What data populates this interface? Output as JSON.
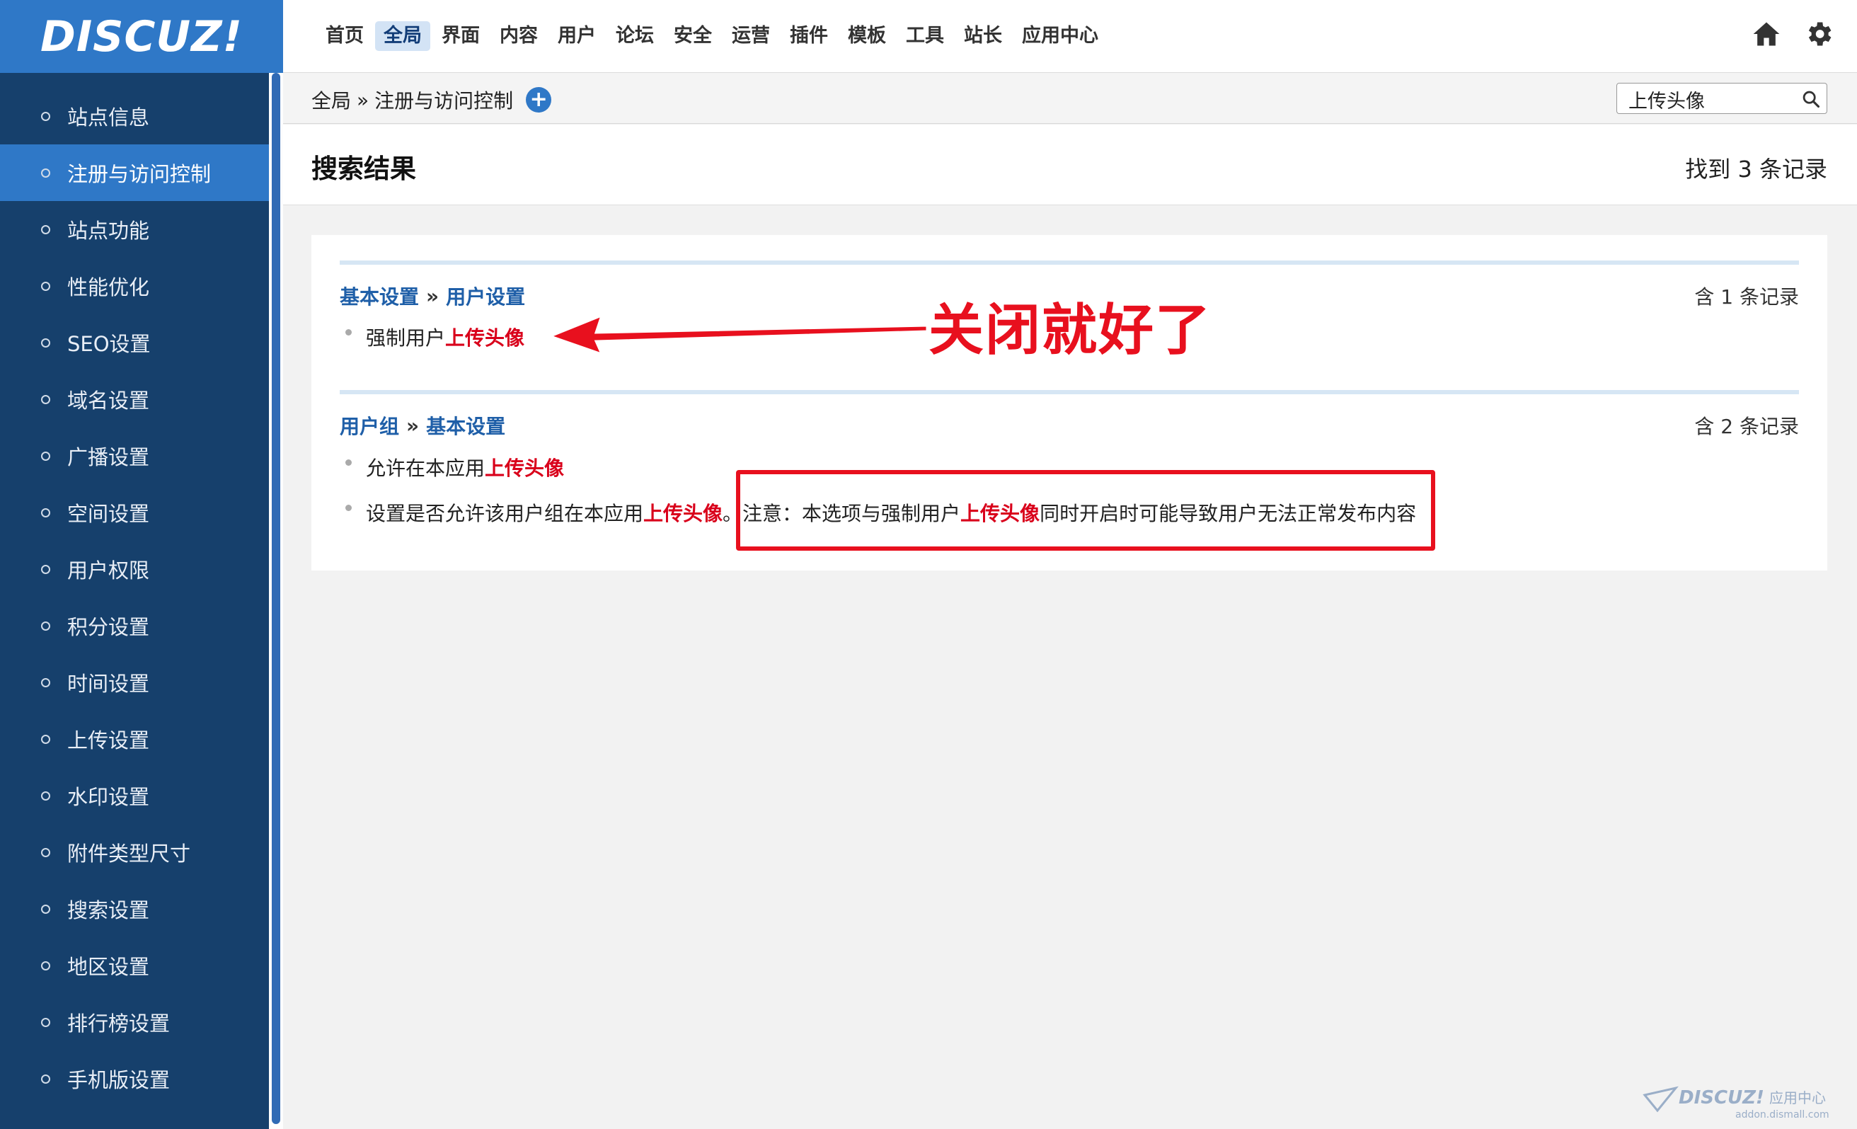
{
  "logo": {
    "text": "DISCUZ!"
  },
  "topnav": {
    "items": [
      "首页",
      "全局",
      "界面",
      "内容",
      "用户",
      "论坛",
      "安全",
      "运营",
      "插件",
      "模板",
      "工具",
      "站长",
      "应用中心"
    ],
    "active_index": 1
  },
  "sidebar": {
    "items": [
      "站点信息",
      "注册与访问控制",
      "站点功能",
      "性能优化",
      "SEO设置",
      "域名设置",
      "广播设置",
      "空间设置",
      "用户权限",
      "积分设置",
      "时间设置",
      "上传设置",
      "水印设置",
      "附件类型尺寸",
      "搜索设置",
      "地区设置",
      "排行榜设置",
      "手机版设置"
    ],
    "active_index": 1
  },
  "breadcrumb": {
    "root": "全局",
    "sep": "»",
    "current": "注册与访问控制"
  },
  "search": {
    "value": "上传头像"
  },
  "result": {
    "title": "搜索结果",
    "count_text": "找到 3 条记录"
  },
  "sections": [
    {
      "crumb1": "基本设置",
      "sep": "»",
      "crumb2": "用户设置",
      "count": "含 1 条记录",
      "items": [
        {
          "pre": "强制用户",
          "hl": "上传头像",
          "post": ""
        }
      ]
    },
    {
      "crumb1": "用户组",
      "sep": "»",
      "crumb2": "基本设置",
      "count": "含 2 条记录",
      "items": [
        {
          "pre": "允许在本应用",
          "hl": "上传头像",
          "post": ""
        },
        {
          "pre": "设置是否允许该用户组在本应用",
          "hl": "上传头像",
          "post": "。注意：本选项与强制用户",
          "hl2": "上传头像",
          "post2": "同时开启时可能导致用户无法正常发布内容"
        }
      ]
    }
  ],
  "annotation": {
    "text": "关闭就好了",
    "color": "#e8101e"
  },
  "watermark": {
    "brand": "DISCUZ!",
    "label": "应用中心",
    "url": "addon.dismall.com"
  },
  "colors": {
    "brand_blue": "#2f78c7",
    "sidebar_bg": "#16406c",
    "highlight_red": "#d9001b",
    "link_blue": "#1f5fa8"
  }
}
